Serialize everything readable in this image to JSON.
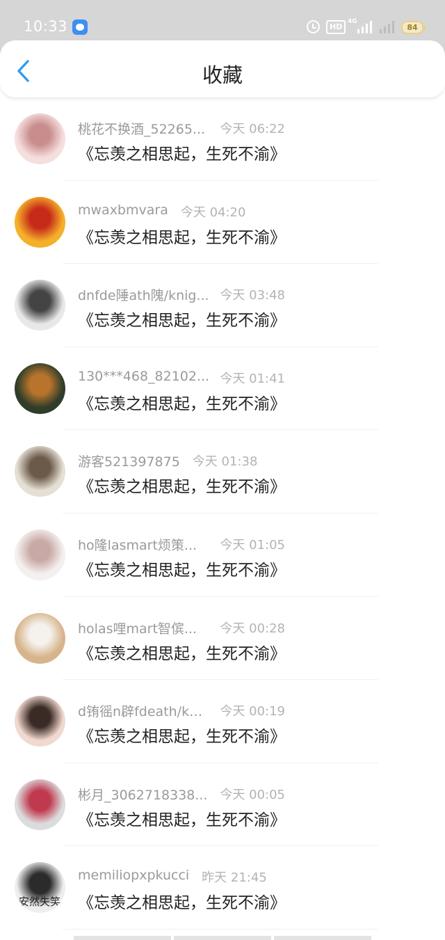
{
  "status_bar": {
    "time": "10:33",
    "hd": "HD",
    "network": "4G",
    "battery": "84"
  },
  "header": {
    "title": "收藏"
  },
  "items": [
    {
      "username": "桃花不换酒_52265...",
      "time": "今天 06:22",
      "content": "《忘羡之相思起，生死不渝》",
      "avatar_colors": [
        "#f6dede",
        "#c98d8d"
      ]
    },
    {
      "username": "mwaxbmvara",
      "time": "今天 04:20",
      "content": "《忘羡之相思起，生死不渝》",
      "avatar_colors": [
        "#f5b02a",
        "#c62b1a"
      ]
    },
    {
      "username": "dnfde陲ath隗/knig...",
      "time": "今天 03:48",
      "content": "《忘羡之相思起，生死不渝》",
      "avatar_colors": [
        "#e8e8e8",
        "#444444"
      ]
    },
    {
      "username": "130***468_82102...",
      "time": "今天 01:41",
      "content": "《忘羡之相思起，生死不渝》",
      "avatar_colors": [
        "#2f3d2a",
        "#b8742c"
      ]
    },
    {
      "username": "游客521397875",
      "time": "今天 01:38",
      "content": "《忘羡之相思起，生死不渝》",
      "avatar_colors": [
        "#e6e0d4",
        "#6b5a4a"
      ]
    },
    {
      "username": "ho隆lasmart烦策...",
      "time": "今天 01:05",
      "content": "《忘羡之相思起，生死不渝》",
      "avatar_colors": [
        "#f4f0ef",
        "#c9a9a6"
      ]
    },
    {
      "username": "holas哩mart智傧...",
      "time": "今天 00:28",
      "content": "《忘羡之相思起，生死不渝》",
      "avatar_colors": [
        "#d7b48c",
        "#f5f2ee"
      ]
    },
    {
      "username": "d铕徭n辟fdeath/kn...",
      "time": "今天 00:19",
      "content": "《忘羡之相思起，生死不渝》",
      "avatar_colors": [
        "#f1d9cf",
        "#3b2b26"
      ]
    },
    {
      "username": "彬月_3062718338...",
      "time": "今天 00:05",
      "content": "《忘羡之相思起，生死不渝》",
      "avatar_colors": [
        "#dcdcdc",
        "#c0394e"
      ]
    },
    {
      "username": "memiliopxpkucci",
      "time": "昨天 21:45",
      "content": "《忘羡之相思起，生死不渝》",
      "avatar_colors": [
        "#eeeeee",
        "#2b2b2b"
      ],
      "avatar_text": "安然失笑"
    }
  ]
}
